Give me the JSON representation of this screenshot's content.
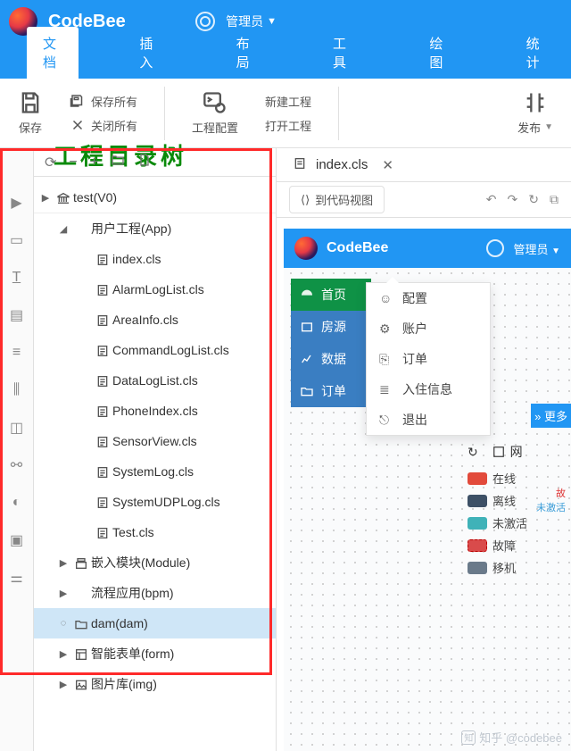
{
  "header": {
    "app_name": "CodeBee",
    "user_name": "管理员"
  },
  "menu": {
    "tabs": [
      "文档",
      "插入",
      "布局",
      "工具",
      "绘图",
      "统计"
    ],
    "active": 0
  },
  "ribbon": {
    "save": "保存",
    "save_all": "保存所有",
    "close_all": "关闭所有",
    "proj_config": "工程配置",
    "new_project": "新建工程",
    "open_project": "打开工程",
    "publish": "发布"
  },
  "overlay_title": "工程目录树",
  "tree": {
    "items": [
      {
        "depth": 0,
        "toggle": "▶",
        "icon": "bank",
        "label": "test(V0)"
      },
      {
        "depth": 1,
        "toggle": "◢",
        "icon": "",
        "label": "用户工程(App)"
      },
      {
        "depth": 2,
        "toggle": "",
        "icon": "file",
        "label": "index.cls"
      },
      {
        "depth": 2,
        "toggle": "",
        "icon": "file",
        "label": "AlarmLogList.cls"
      },
      {
        "depth": 2,
        "toggle": "",
        "icon": "file",
        "label": "AreaInfo.cls"
      },
      {
        "depth": 2,
        "toggle": "",
        "icon": "file",
        "label": "CommandLogList.cls"
      },
      {
        "depth": 2,
        "toggle": "",
        "icon": "file",
        "label": "DataLogList.cls"
      },
      {
        "depth": 2,
        "toggle": "",
        "icon": "file",
        "label": "PhoneIndex.cls"
      },
      {
        "depth": 2,
        "toggle": "",
        "icon": "file",
        "label": "SensorView.cls"
      },
      {
        "depth": 2,
        "toggle": "",
        "icon": "file",
        "label": "SystemLog.cls"
      },
      {
        "depth": 2,
        "toggle": "",
        "icon": "file",
        "label": "SystemUDPLog.cls"
      },
      {
        "depth": 2,
        "toggle": "",
        "icon": "file",
        "label": "Test.cls"
      },
      {
        "depth": 1,
        "toggle": "▶",
        "icon": "module",
        "label": "嵌入模块(Module)"
      },
      {
        "depth": 1,
        "toggle": "▶",
        "icon": "",
        "label": "流程应用(bpm)"
      },
      {
        "depth": 1,
        "toggle": "",
        "icon": "folder",
        "label": "dam(dam)",
        "selected": true,
        "spinner": true
      },
      {
        "depth": 1,
        "toggle": "▶",
        "icon": "form",
        "label": "智能表单(form)"
      },
      {
        "depth": 1,
        "toggle": "▶",
        "icon": "image",
        "label": "图片库(img)"
      }
    ]
  },
  "editor_tab": {
    "label": "index.cls"
  },
  "toolbar2": {
    "code_view": "到代码视图"
  },
  "mini": {
    "app_name": "CodeBee",
    "user_name": "管理员",
    "nav": [
      {
        "label": "首页",
        "color": "green",
        "icon": "dashboard"
      },
      {
        "label": "房源",
        "color": "blue",
        "icon": "house"
      },
      {
        "label": "数据",
        "color": "blue",
        "icon": "chart"
      },
      {
        "label": "订单",
        "color": "blue",
        "icon": "folder"
      }
    ],
    "dropdown": [
      "配置",
      "账户",
      "订单",
      "入住信息",
      "退出"
    ],
    "more": "» 更多",
    "legend_title": "网",
    "legend": [
      "在线",
      "离线",
      "未激活",
      "故障",
      "移机"
    ],
    "activation": {
      "line1": "故",
      "line2": "未激活"
    }
  },
  "watermark": "知乎 @codebee"
}
